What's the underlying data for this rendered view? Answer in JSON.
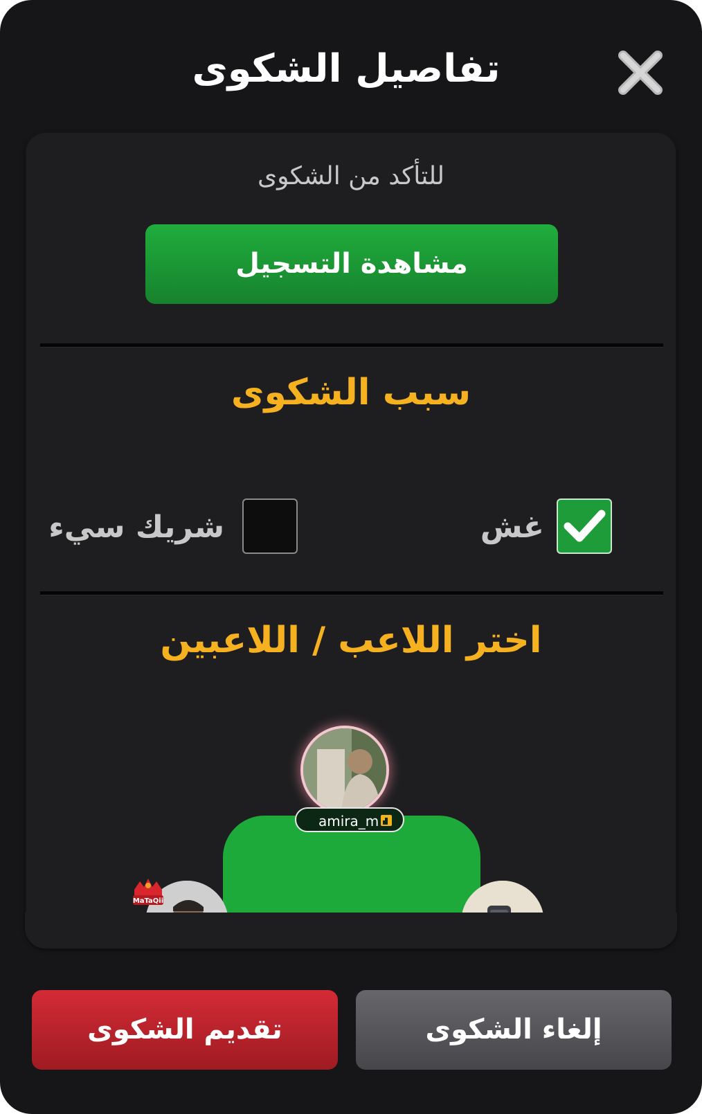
{
  "dialog": {
    "title": "تفاصيل الشكوى",
    "close_icon": "close-x-icon"
  },
  "verification": {
    "hint": "للتأكد من الشكوى",
    "watch_button": "مشاهدة التسجيل"
  },
  "reason": {
    "heading": "سبب الشكوى",
    "options": [
      {
        "label": "غش",
        "checked": true
      },
      {
        "label": "شريك سيء",
        "checked": false
      }
    ]
  },
  "players": {
    "heading": "اختر اللاعب / اللاعبين",
    "top_player": {
      "name": "amira_m",
      "badge_icon": "id-badge-icon"
    },
    "left_player_logo": "MaTaQii"
  },
  "footer": {
    "submit_button": "تقديم الشكوى",
    "cancel_button": "إلغاء الشكوى"
  },
  "colors": {
    "accent_orange": "#f5b11f",
    "green": "#1ea93b",
    "red": "#c7252f",
    "gray_button": "#5a5a5e",
    "background": "#161618"
  }
}
